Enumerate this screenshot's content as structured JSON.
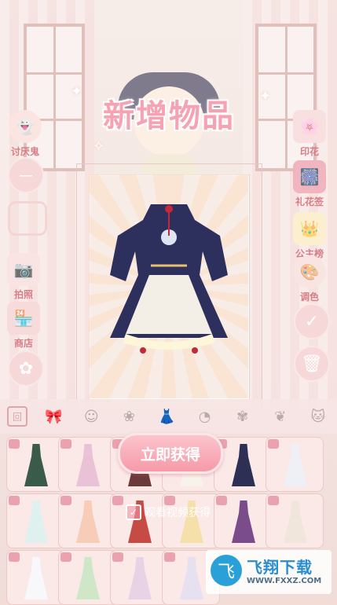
{
  "title": "新增物品",
  "left_menu": [
    {
      "label": "讨厌鬼",
      "icon": "ghost-icon"
    },
    {
      "label": "",
      "icon": "minus-icon"
    },
    {
      "label": "",
      "icon": "hanger-icon"
    },
    {
      "label": "拍照",
      "icon": "camera-icon"
    },
    {
      "label": "商店",
      "icon": "shop-icon"
    },
    {
      "label": "",
      "icon": "flower-icon"
    }
  ],
  "right_menu": [
    {
      "label": "印花",
      "icon": "stamp-icon"
    },
    {
      "label": "礼花签",
      "icon": "firework-icon"
    },
    {
      "label": "公主榜",
      "icon": "crown-icon"
    },
    {
      "label": "调色",
      "icon": "palette-icon"
    },
    {
      "label": "",
      "icon": "check-icon"
    },
    {
      "label": "",
      "icon": "trash-icon"
    }
  ],
  "new_item": {
    "name": "dark qipao lolita dress"
  },
  "tabs": [
    "frame-icon",
    "bow-icon",
    "head-icon",
    "lotus-icon",
    "dress-icon",
    "fan-icon",
    "lotus-icon",
    "leaf-icon",
    "cat-icon"
  ],
  "grid_items": [
    {
      "color": "#3a5a4a"
    },
    {
      "color": "#e9c2d8"
    },
    {
      "color": "#6b3a3a"
    },
    {
      "color": "#f8f3ea"
    },
    {
      "color": "#2e2f55"
    },
    {
      "color": "#eef0f6"
    },
    {
      "color": "#dff1ee"
    },
    {
      "color": "#f7cdb9"
    },
    {
      "color": "#c74b45"
    },
    {
      "color": "#f6e0a9"
    },
    {
      "color": "#7a4c8c"
    },
    {
      "color": "#f0e6dc"
    },
    {
      "color": "#f8f8fb"
    },
    {
      "color": "#cfe7c6"
    },
    {
      "color": "#e7d2e6"
    },
    {
      "color": "#e7e0f0"
    }
  ],
  "cta": {
    "label": "立即获得"
  },
  "video": {
    "label": "观看视频获得",
    "checked": "✓"
  },
  "watermark": {
    "logo": "飞",
    "name": "飞翔下载",
    "url": "WWW.FXXZ.COM"
  },
  "colors": {
    "accent": "#f69aa8",
    "title": "#f7a2b2",
    "label": "#c23a48"
  }
}
